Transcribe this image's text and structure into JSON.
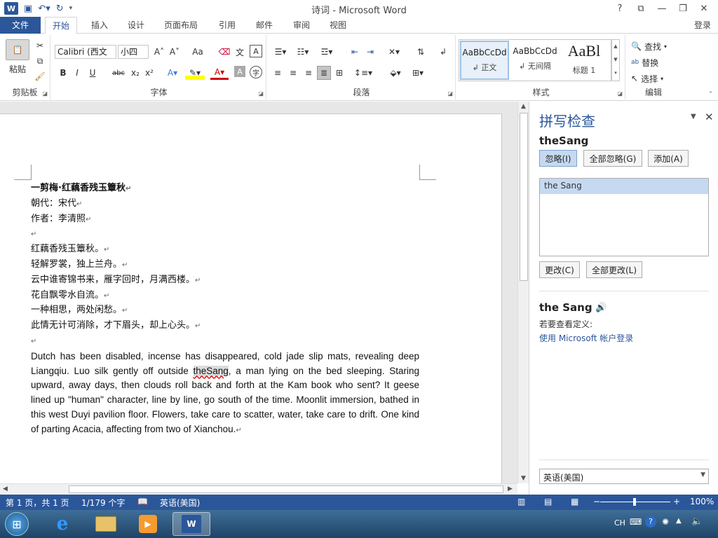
{
  "window": {
    "title": "诗词 - Microsoft Word",
    "help": "?",
    "signin": "登录"
  },
  "tabs": {
    "file": "文件",
    "home": "开始",
    "insert": "插入",
    "design": "设计",
    "layout": "页面布局",
    "references": "引用",
    "mailings": "邮件",
    "review": "审阅",
    "view": "视图"
  },
  "ribbon": {
    "clipboard": {
      "label": "剪贴板",
      "paste": "粘贴"
    },
    "font": {
      "label": "字体",
      "font_name": "Calibri (西文",
      "font_size": "小四",
      "bold": "B",
      "italic": "I",
      "underline": "U",
      "strike": "abc",
      "sub": "x₂",
      "sup": "x²",
      "aa": "Aa"
    },
    "paragraph": {
      "label": "段落"
    },
    "styles": {
      "label": "样式",
      "items": [
        {
          "preview": "AaBbCcDd",
          "name": "↲ 正文"
        },
        {
          "preview": "AaBbCcDd",
          "name": "↲ 无间隔"
        },
        {
          "preview": "AaBl",
          "name": "标题 1"
        }
      ]
    },
    "editing": {
      "label": "编辑",
      "find": "查找",
      "replace": "替换",
      "select": "选择"
    }
  },
  "document": {
    "title": "一剪梅·红藕香残玉簟秋",
    "dynasty": "朝代：宋代",
    "author": "作者：李清照",
    "lines": [
      "红藕香残玉簟秋。",
      "轻解罗裳，独上兰舟。",
      "云中谁寄锦书来，雁字回时，月满西楼。",
      "花自飘零水自流。",
      "一种相思，两处闲愁。",
      "此情无计可消除，才下眉头，却上心头。"
    ],
    "para_before": "Dutch has been disabled, incense has disappeared, cold jade slip mats, revealing deep Liangqiu. Luo silk gently off outside ",
    "misspelled": "theSang",
    "para_after": ", a man lying on the bed sleeping. Staring upward, away days, then clouds roll back and forth at the Kam book who sent? It geese lined up \"human\" character, line by line, go south of the time. Moonlit immersion, bathed in this west Duyi pavilion floor. Flowers, take care to scatter, water, take care to drift. One kind of parting Acacia, affecting from two of Xianchou.",
    "para_mark": "↵"
  },
  "spell_pane": {
    "title": "拼写检查",
    "word": "theSang",
    "ignore": "忽略(I)",
    "ignore_all": "全部忽略(G)",
    "add": "添加(A)",
    "suggestion": "the Sang",
    "change": "更改(C)",
    "change_all": "全部更改(L)",
    "def_word": "the Sang",
    "def_hint": "若要查看定义:",
    "def_link": "使用 Microsoft 帐户登录",
    "language": "英语(美国)"
  },
  "status": {
    "page": "第 1 页，共 1 页",
    "words": "1/179 个字",
    "language": "英语(美国)",
    "zoom": "100%"
  },
  "taskbar": {
    "tray_lang": "CH",
    "start_icon": "windows-logo-icon"
  }
}
